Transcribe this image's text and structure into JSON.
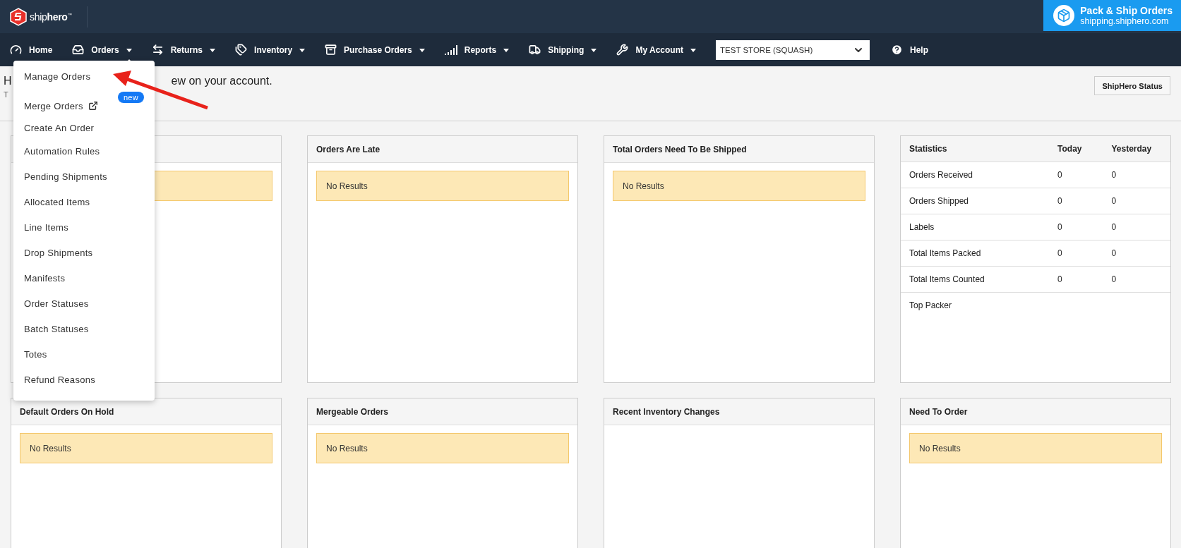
{
  "brand": {
    "name_light": "ship",
    "name_bold": "hero",
    "mark": "™"
  },
  "promo": {
    "title": "Pack & Ship Orders",
    "url": "shipping.shiphero.com"
  },
  "nav": [
    {
      "label": "Home",
      "kind": "link"
    },
    {
      "label": "Orders",
      "kind": "menu",
      "expanded": true
    },
    {
      "label": "Returns",
      "kind": "menu",
      "expanded": false
    },
    {
      "label": "Inventory",
      "kind": "menu",
      "expanded": false
    },
    {
      "label": "Purchase Orders",
      "kind": "menu",
      "expanded": false
    },
    {
      "label": "Reports",
      "kind": "menu",
      "expanded": false
    },
    {
      "label": "Shipping",
      "kind": "menu",
      "expanded": false
    },
    {
      "label": "My Account",
      "kind": "menu",
      "expanded": false
    }
  ],
  "store_select": {
    "value": "TEST STORE (SQUASH)"
  },
  "help": {
    "label": "Help"
  },
  "orders_menu": [
    {
      "label": "Manage Orders"
    },
    {
      "label": "Merge Orders",
      "external": true,
      "badge": "new"
    },
    {
      "label": "Create An Order"
    },
    {
      "label": "Automation Rules"
    },
    {
      "label": "Pending Shipments"
    },
    {
      "label": "Allocated Items"
    },
    {
      "label": "Line Items"
    },
    {
      "label": "Drop Shipments"
    },
    {
      "label": "Manifests"
    },
    {
      "label": "Order Statuses"
    },
    {
      "label": "Batch Statuses"
    },
    {
      "label": "Totes"
    },
    {
      "label": "Refund Reasons"
    }
  ],
  "header": {
    "heading_start": "H",
    "heading_end": "ew on your account.",
    "subheading_start": "T",
    "status_button": "ShipHero Status"
  },
  "panels": [
    {
      "kind": "blank"
    },
    {
      "kind": "alert",
      "title": "Orders Are Late",
      "message": "No Results"
    },
    {
      "kind": "alert",
      "title": "Total Orders Need To Be Shipped",
      "message": "No Results"
    },
    {
      "kind": "stats",
      "columns": [
        "Statistics",
        "Today",
        "Yesterday"
      ],
      "rows": [
        [
          "Orders Received",
          "0",
          "0"
        ],
        [
          "Orders Shipped",
          "0",
          "0"
        ],
        [
          "Labels",
          "0",
          "0"
        ],
        [
          "Total Items Packed",
          "0",
          "0"
        ],
        [
          "Total Items Counted",
          "0",
          "0"
        ],
        [
          "Top Packer"
        ]
      ]
    },
    {
      "kind": "alert",
      "title": "Default Orders On Hold",
      "message": "No Results"
    },
    {
      "kind": "alert",
      "title": "Mergeable Orders",
      "message": "No Results"
    },
    {
      "kind": "empty",
      "title": "Recent Inventory Changes"
    },
    {
      "kind": "alert",
      "title": "Need To Order",
      "message": "No Results"
    }
  ]
}
